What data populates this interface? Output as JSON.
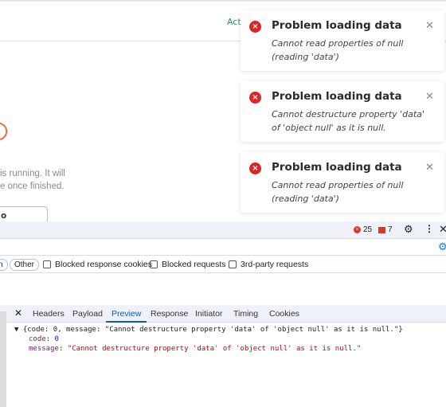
{
  "page": {
    "header_link": "Acti",
    "running_line1": "is running. It will",
    "running_line2": "e once finished.",
    "execution_button": "o Execution",
    "accent_color": "#ff5a36"
  },
  "devtools": {
    "error_count": "25",
    "warning_count": "7",
    "filter_chips": [
      "n",
      "Other"
    ],
    "checkboxes": [
      "Blocked response cookies",
      "Blocked requests",
      "3rd-party requests"
    ],
    "tabs": [
      "Headers",
      "Payload",
      "Preview",
      "Response",
      "Initiator",
      "Timing",
      "Cookies"
    ],
    "selected_tab": "Preview",
    "preview": {
      "summary": "{code: 0, message: \"Cannot destructure property 'data' of 'object null' as it is null.\"}",
      "code_key": "code",
      "code_value": "0",
      "message_key": "message",
      "message_value": "\"Cannot destructure property 'data' of 'object null' as it is null.\""
    }
  },
  "toasts": [
    {
      "title": "Problem loading data",
      "message": "Cannot read properties of null (reading 'data')"
    },
    {
      "title": "Problem loading data",
      "message": "Cannot destructure property 'data' of 'object null' as it is null."
    },
    {
      "title": "Problem loading data",
      "message": "Cannot read properties of null (reading 'data')"
    }
  ]
}
